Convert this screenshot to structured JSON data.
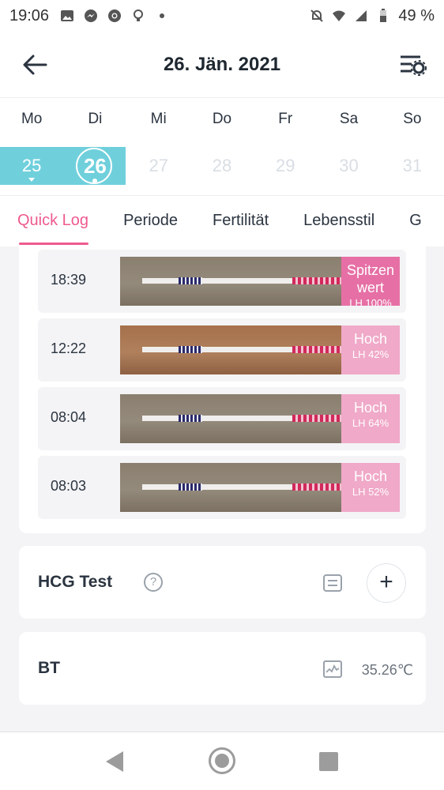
{
  "status_bar": {
    "time": "19:06",
    "battery": "49 %",
    "left_icons": [
      "image-icon",
      "messenger-icon",
      "chrome-icon",
      "bulb-icon",
      "dot-icon"
    ],
    "right_icons": [
      "mute-icon",
      "wifi-icon",
      "signal-icon",
      "battery-icon"
    ]
  },
  "header": {
    "title": "26. Jän. 2021"
  },
  "week": {
    "days": [
      "Mo",
      "Di",
      "Mi",
      "Do",
      "Fr",
      "Sa",
      "So"
    ],
    "dates": [
      "25",
      "26",
      "27",
      "28",
      "29",
      "30",
      "31"
    ],
    "selected_index": 1
  },
  "tabs": [
    "Quick Log",
    "Periode",
    "Fertilität",
    "Lebensstil",
    "G"
  ],
  "lh_tests": [
    {
      "time": "18:39",
      "level": "Spitzen wert",
      "value": "LH 100%"
    },
    {
      "time": "12:22",
      "level": "Hoch",
      "value": "LH 42%"
    },
    {
      "time": "08:04",
      "level": "Hoch",
      "value": "LH 64%"
    },
    {
      "time": "08:03",
      "level": "Hoch",
      "value": "LH 52%"
    }
  ],
  "hcg": {
    "label": "HCG Test",
    "help": "?",
    "add": "+"
  },
  "bt": {
    "label": "BT",
    "value": "35.26℃"
  },
  "colors": {
    "accent": "#ef5a8e",
    "calendar_highlight": "#6fd0dc",
    "badge_peak": "#e670a5",
    "badge_high": "#f0a9c8"
  }
}
